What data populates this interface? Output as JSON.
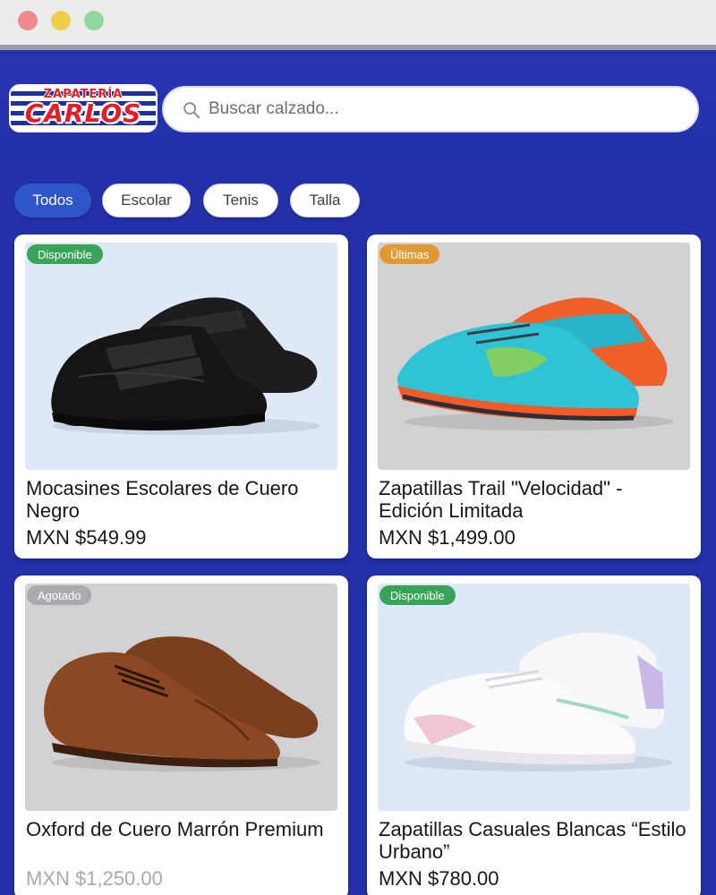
{
  "window": {
    "controls": [
      "close",
      "minimize",
      "maximize"
    ]
  },
  "header": {
    "logo_top": "ZAPATERÍA",
    "logo_main": "CARLOS",
    "search_placeholder": "Buscar calzado..."
  },
  "filters": [
    {
      "label": "Todos",
      "active": true
    },
    {
      "label": "Escolar",
      "active": false
    },
    {
      "label": "Tenis",
      "active": false
    },
    {
      "label": "Talla",
      "active": false
    }
  ],
  "products": [
    {
      "badge": "Disponible",
      "badge_color": "#3aa35a",
      "title": "Mocasines Escolares de Cuero Negro",
      "price": "MXN $549.99",
      "image": "black-velcro-school-shoe"
    },
    {
      "badge": "Últimas",
      "badge_color": "#e09a34",
      "title": "Zapatillas Trail \"Velocidad\" - Edición Limitada",
      "price": "MXN $1,499.00",
      "image": "turquoise-orange-trail-sneaker"
    },
    {
      "badge": "Agotado",
      "badge_color": "#a9abb0",
      "title": "Oxford de Cuero Marrón Premium",
      "price": "MXN $1,250.00",
      "image": "brown-leather-oxford-shoe"
    },
    {
      "badge": "Disponible",
      "badge_color": "#3aa35a",
      "title": "Zapatillas Casuales Blancas “Estilo Urbano”",
      "price": "MXN $780.00",
      "image": "white-pastel-casual-sneaker"
    }
  ],
  "colors": {
    "background": "#2430a8",
    "accent": "#2d57c8",
    "available": "#3aa35a",
    "last_units": "#e09a34",
    "sold_out": "#a9abb0"
  }
}
